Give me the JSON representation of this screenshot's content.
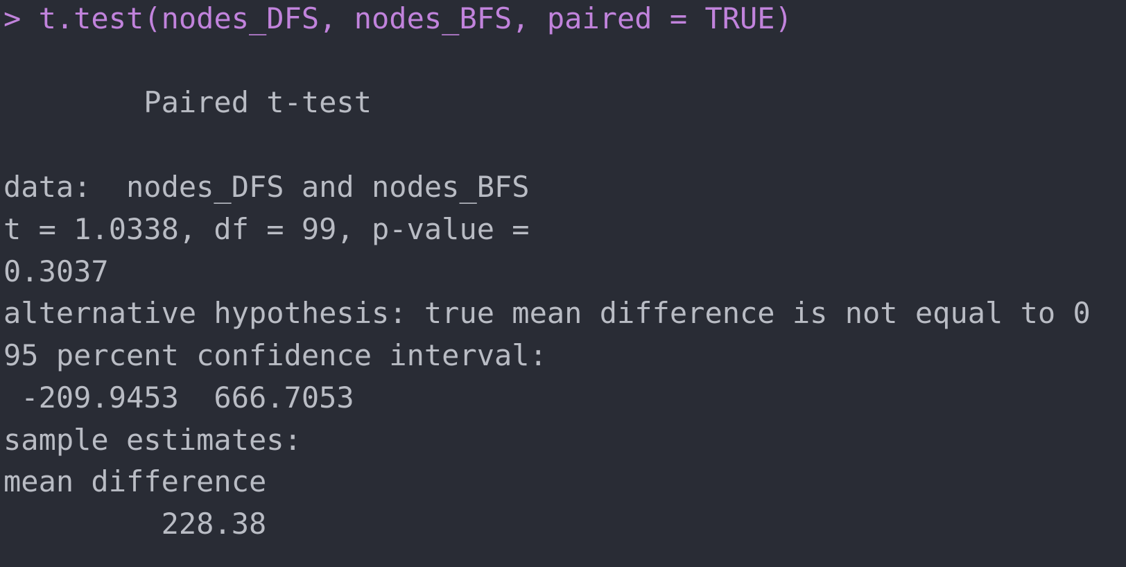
{
  "console": {
    "prompt": "> ",
    "command": "t.test(nodes_DFS, nodes_BFS, paired = TRUE)",
    "output_lines": [
      "        Paired t-test",
      "data:  nodes_DFS and nodes_BFS",
      "t = 1.0338, df = 99, p-value =",
      "0.3037",
      "alternative hypothesis: true mean difference is not equal to 0",
      "95 percent confidence interval:",
      " -209.9453  666.7053",
      "sample estimates:",
      "mean difference",
      "         228.38"
    ]
  },
  "colors": {
    "background": "#292c35",
    "command_text": "#c183dc",
    "output_text": "#b9bcc4"
  }
}
